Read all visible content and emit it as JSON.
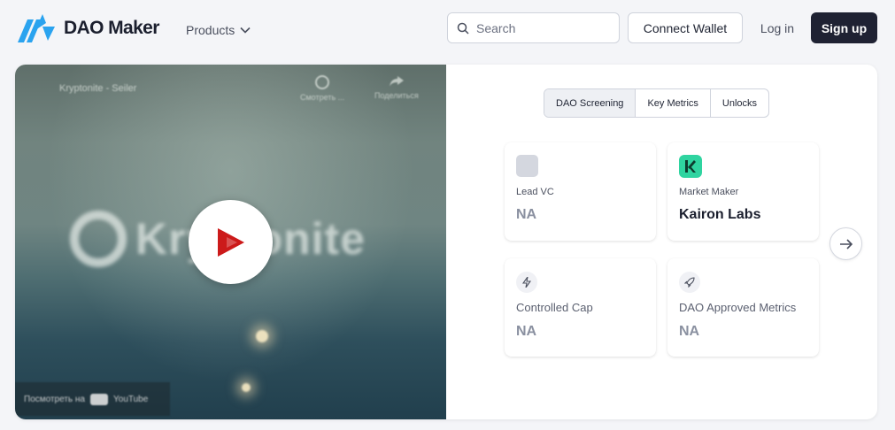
{
  "header": {
    "brand": "DAO Maker",
    "nav_products": "Products",
    "search_placeholder": "Search",
    "connect_wallet": "Connect Wallet",
    "login": "Log in",
    "signup": "Sign up"
  },
  "video": {
    "title": "Kryptonite - Seiler",
    "action_watch_later": "Смотреть ...",
    "action_share": "Поделиться",
    "brand_text": "Kryptonite",
    "watch_on": "Посмотреть на",
    "youtube": "YouTube"
  },
  "tabs": [
    {
      "label": "DAO Screening",
      "active": true
    },
    {
      "label": "Key Metrics",
      "active": false
    },
    {
      "label": "Unlocks",
      "active": false
    }
  ],
  "metrics": {
    "lead_vc": {
      "label": "Lead VC",
      "value": "NA"
    },
    "market_maker": {
      "label": "Market Maker",
      "value": "Kairon Labs"
    },
    "controlled_cap": {
      "label": "Controlled Cap",
      "value": "NA"
    },
    "dao_approved": {
      "label": "DAO Approved Metrics",
      "value": "NA"
    }
  },
  "colors": {
    "brand_blue": "#2aa3ef",
    "signup_bg": "#1f2233",
    "kairon_green": "#2fd4a0",
    "play_red": "#cc1a1a"
  },
  "icons": {
    "search": "search-icon",
    "chevron": "chevron-down-icon",
    "controlled_cap": "lightning-icon",
    "dao_approved": "rocket-icon",
    "next": "arrow-right-icon"
  }
}
